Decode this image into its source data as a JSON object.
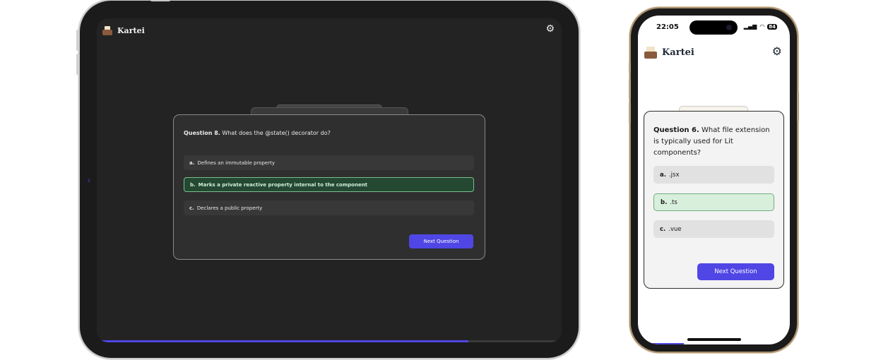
{
  "app": {
    "name": "Kartei"
  },
  "colors": {
    "accent": "#4f46e5",
    "correct_dark": "#244832",
    "correct_light": "#d8efdc"
  },
  "tablet": {
    "question": {
      "number": "Question 8.",
      "text": "What does the @state() decorator do?"
    },
    "options": [
      {
        "letter": "a.",
        "text": "Defines an immutable property",
        "state": "default"
      },
      {
        "letter": "b.",
        "text": "Marks a private reactive property internal to the component",
        "state": "correct"
      },
      {
        "letter": "c.",
        "text": "Declares a public property",
        "state": "default"
      }
    ],
    "next_button": "Next Question",
    "progress": 0.8,
    "page_indicator": "2"
  },
  "phone": {
    "status": {
      "time": "22:05",
      "battery": "84"
    },
    "question": {
      "number": "Question 6.",
      "text": "What file extension is typically used for Lit components?"
    },
    "options": [
      {
        "letter": "a.",
        "text": ".jsx",
        "state": "default"
      },
      {
        "letter": "b.",
        "text": ".ts",
        "state": "correct"
      },
      {
        "letter": "c.",
        "text": ".vue",
        "state": "default"
      }
    ],
    "next_button": "Next Question",
    "progress": 0.3
  }
}
